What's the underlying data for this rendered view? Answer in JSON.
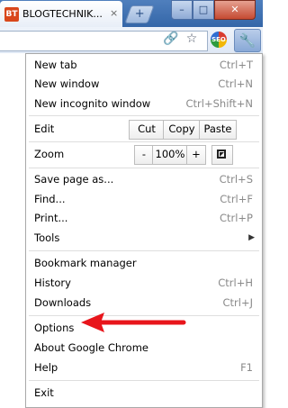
{
  "tab": {
    "favicon_text": "BT",
    "title": "BLOGTECHNIK...",
    "close_glyph": "×"
  },
  "window_controls": {
    "minimize": "–",
    "maximize": "□",
    "close": "✕"
  },
  "toolbar": {
    "link_icon": "link-icon",
    "star_icon": "star-icon",
    "seo_label": "SEO",
    "wrench_icon": "wrench-icon"
  },
  "menu": {
    "new_tab": {
      "label": "New tab",
      "shortcut": "Ctrl+T"
    },
    "new_window": {
      "label": "New window",
      "shortcut": "Ctrl+N"
    },
    "new_incognito": {
      "label": "New incognito window",
      "shortcut": "Ctrl+Shift+N"
    },
    "edit": {
      "label": "Edit",
      "cut": "Cut",
      "copy": "Copy",
      "paste": "Paste"
    },
    "zoom": {
      "label": "Zoom",
      "minus": "-",
      "level": "100%",
      "plus": "+"
    },
    "save_page": {
      "label": "Save page as...",
      "shortcut": "Ctrl+S"
    },
    "find": {
      "label": "Find...",
      "shortcut": "Ctrl+F"
    },
    "print": {
      "label": "Print...",
      "shortcut": "Ctrl+P"
    },
    "tools": {
      "label": "Tools",
      "arrow": "▶"
    },
    "bookmark_manager": {
      "label": "Bookmark manager"
    },
    "history": {
      "label": "History",
      "shortcut": "Ctrl+H"
    },
    "downloads": {
      "label": "Downloads",
      "shortcut": "Ctrl+J"
    },
    "options": {
      "label": "Options"
    },
    "about": {
      "label": "About Google Chrome"
    },
    "help": {
      "label": "Help",
      "shortcut": "F1"
    },
    "exit": {
      "label": "Exit"
    }
  },
  "colors": {
    "annotation_arrow": "#e8151b",
    "title_bar": "#3466a8"
  }
}
